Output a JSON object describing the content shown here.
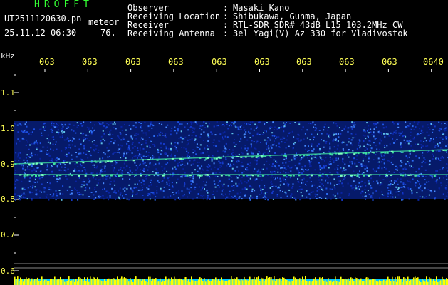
{
  "header": {
    "brand": "HROFFT",
    "filename": "UT2511120630.pn",
    "filename_suffix": "meteor",
    "timestamp": "25.11.12 06:30",
    "count": "76."
  },
  "metadata": [
    {
      "label": "Observer",
      "value": "Masaki Kano"
    },
    {
      "label": "Receiving Location",
      "value": "Shibukawa, Gunma, Japan"
    },
    {
      "label": "Receiver",
      "value": "RTL-SDR SDR# 43dB L15 103.2MHz CW"
    },
    {
      "label": "Receiving Antenna",
      "value": "3el Yagi(V) Az 330 for Vladivostok"
    }
  ],
  "colors": {
    "background": "#000000",
    "label_text": "#ffffff",
    "axis_text": "#ffff55",
    "brand": "#33ff33",
    "signal_band": "#1438c8",
    "signal_peak": "#40e0a0",
    "amplitude_bar": "#ffff00",
    "amplitude_base": "#00c8ff"
  },
  "chart_data": {
    "type": "heatmap",
    "ylabel": "kHz",
    "y_ticks": [
      "1.1",
      "1.0",
      "0.9",
      "0.8",
      "0.7",
      "0.6"
    ],
    "x_ticks": [
      "063",
      "063",
      "063",
      "063",
      "063",
      "063",
      "063",
      "063",
      "063",
      "0640"
    ],
    "ylim": [
      0.6,
      1.15
    ],
    "noise_band_khz": [
      0.8,
      1.02
    ],
    "signal_traces_khz": [
      {
        "start": 0.9,
        "end": 0.94
      },
      {
        "start": 0.87,
        "end": 0.87
      }
    ]
  }
}
